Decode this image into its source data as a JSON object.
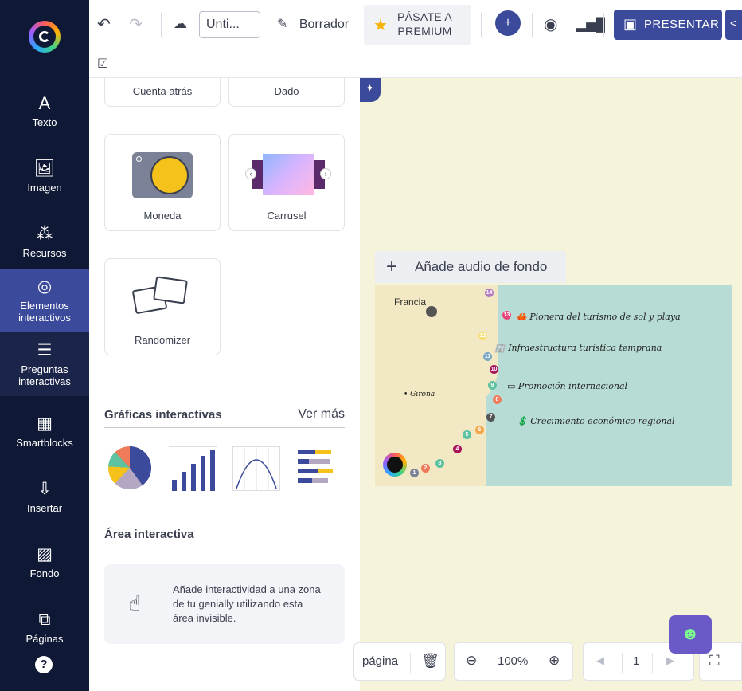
{
  "rail": {
    "items": [
      {
        "label": "Texto",
        "icon": "text-icon"
      },
      {
        "label": "Imagen",
        "icon": "image-icon"
      },
      {
        "label": "Recursos",
        "icon": "resources-icon"
      },
      {
        "label": "Elementos interactivos",
        "icon": "interactive-elements-icon"
      },
      {
        "label": "Preguntas interactivas",
        "icon": "questions-icon"
      },
      {
        "label": "Smartblocks",
        "icon": "smartblocks-icon"
      },
      {
        "label": "Insertar",
        "icon": "insert-icon"
      },
      {
        "label": "Fondo",
        "icon": "background-icon"
      },
      {
        "label": "Páginas",
        "icon": "pages-icon"
      }
    ],
    "help": "?"
  },
  "topbar": {
    "title_value": "Unti...",
    "draft_label": "Borrador",
    "premium_label_1": "PÁSATE A",
    "premium_label_2": "PREMIUM",
    "present_label": "PRESENTAR"
  },
  "panel": {
    "top_cards": [
      "Cuenta atrás",
      "Dado"
    ],
    "cards": [
      "Moneda",
      "Carrusel",
      "Randomizer"
    ],
    "charts_title": "Gráficas interactivas",
    "see_more": "Ver más",
    "area_title": "Área interactiva",
    "area_text": "Añade interactividad a una zona de tu genially utilizando esta área invisible."
  },
  "canvas": {
    "audio_label": "Añade audio de fondo",
    "map": {
      "country_label": "Francia",
      "city_label": "• Girona",
      "legend": [
        {
          "num": "13",
          "text": "Pionera del turismo de sol y playa",
          "color": "#e6457a"
        },
        {
          "num": "",
          "text": "Infraestructura turística temprana",
          "color": "#3a3f4f"
        },
        {
          "num": "",
          "text": "Promoción internacional",
          "color": "#3a3f4f"
        },
        {
          "num": "",
          "text": "Crecimiento económico regional",
          "color": "#3a3f4f"
        }
      ]
    }
  },
  "bottombar": {
    "page_label": "página",
    "zoom": "100%",
    "page_number": "1"
  }
}
